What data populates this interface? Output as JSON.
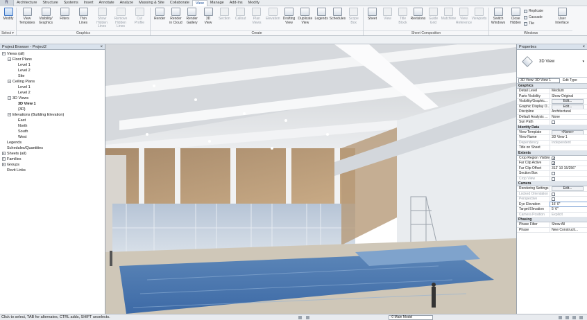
{
  "ribbon_tabs": [
    "Architecture",
    "Structure",
    "Systems",
    "Insert",
    "Annotate",
    "Analyze",
    "Massing & Site",
    "Collaborate",
    "View",
    "Manage",
    "Add-Ins",
    "Modify"
  ],
  "active_tab": "View",
  "ribbon": {
    "modify": "Modify",
    "select": "Select ▾",
    "graphics_buttons": [
      "View\nTemplates",
      "Visibility/\nGraphics",
      "Filters",
      "Thin\nLines",
      "Show\nHidden Lines",
      "Remove\nHidden Lines",
      "Cut\nProfile"
    ],
    "graphics_label": "Graphics",
    "create_buttons": [
      "Render",
      "Render\nin Cloud",
      "Render\nGallery",
      "3D\nView",
      "Section",
      "Callout",
      "Plan\nViews",
      "Elevation",
      "Drafting\nView",
      "Duplicate\nView",
      "Legends",
      "Schedules",
      "Scope\nBox"
    ],
    "create_label": "Create",
    "sheet_buttons": [
      "Sheet",
      "View",
      "Title\nBlock",
      "Revisions",
      "Guide\nGrid",
      "Matchline",
      "View\nReference",
      "Viewports"
    ],
    "sheet_label": "Sheet Composition",
    "window_buttons": [
      "Switch\nWindows",
      "Close\nHidden"
    ],
    "window_small": [
      "Replicate",
      "Cascade",
      "Tile"
    ],
    "user_interface": "User\nInterface",
    "windows_label": "Windows"
  },
  "browser": {
    "title": "Project Browser - Project2",
    "close": "×",
    "rows": [
      {
        "indent": 0,
        "toggle": "−",
        "text": "Views (all)"
      },
      {
        "indent": 1,
        "toggle": "−",
        "text": "Floor Plans"
      },
      {
        "indent": 2,
        "toggle": "",
        "text": "Level 1"
      },
      {
        "indent": 2,
        "toggle": "",
        "text": "Level 2"
      },
      {
        "indent": 2,
        "toggle": "",
        "text": "Site"
      },
      {
        "indent": 1,
        "toggle": "−",
        "text": "Ceiling Plans"
      },
      {
        "indent": 2,
        "toggle": "",
        "text": "Level 1"
      },
      {
        "indent": 2,
        "toggle": "",
        "text": "Level 2"
      },
      {
        "indent": 1,
        "toggle": "−",
        "text": "3D Views"
      },
      {
        "indent": 2,
        "toggle": "",
        "text": "3D View 1",
        "bold": true
      },
      {
        "indent": 2,
        "toggle": "",
        "text": "{3D}"
      },
      {
        "indent": 1,
        "toggle": "−",
        "text": "Elevations (Building Elevation)"
      },
      {
        "indent": 2,
        "toggle": "",
        "text": "East"
      },
      {
        "indent": 2,
        "toggle": "",
        "text": "North"
      },
      {
        "indent": 2,
        "toggle": "",
        "text": "South"
      },
      {
        "indent": 2,
        "toggle": "",
        "text": "West"
      },
      {
        "indent": 0,
        "toggle": "",
        "text": "Legends"
      },
      {
        "indent": 0,
        "toggle": "",
        "text": "Schedules/Quantities"
      },
      {
        "indent": 0,
        "toggle": "+",
        "text": "Sheets (all)"
      },
      {
        "indent": 0,
        "toggle": "+",
        "text": "Families"
      },
      {
        "indent": 0,
        "toggle": "+",
        "text": "Groups"
      },
      {
        "indent": 0,
        "toggle": "",
        "text": "Revit Links"
      }
    ]
  },
  "properties": {
    "title": "Properties",
    "close": "×",
    "type_name": "3D View",
    "selector": "3D View: 3D View 1",
    "edit_type": "Edit Type",
    "groups": [
      {
        "name": "Graphics",
        "rows": [
          {
            "k": "Detail Level",
            "v": "Medium"
          },
          {
            "k": "Parts Visibility",
            "v": "Show Original"
          },
          {
            "k": "Visibility/Graphic...",
            "v": "Edit...",
            "btn": true
          },
          {
            "k": "Graphic Display O...",
            "v": "Edit...",
            "btn": true
          },
          {
            "k": "Discipline",
            "v": "Architectural"
          },
          {
            "k": "Default Analysis ...",
            "v": "None"
          },
          {
            "k": "Sun Path",
            "v": "",
            "cb": true
          }
        ]
      },
      {
        "name": "Identity Data",
        "rows": [
          {
            "k": "View Template",
            "v": "<None>",
            "btn": true
          },
          {
            "k": "View Name",
            "v": "3D View 1"
          },
          {
            "k": "Dependency",
            "v": "Independent",
            "dim": true
          },
          {
            "k": "Title on Sheet",
            "v": ""
          }
        ]
      },
      {
        "name": "Extents",
        "rows": [
          {
            "k": "Crop Region Visible",
            "v": "✓",
            "cb": true
          },
          {
            "k": "Far Clip Active",
            "v": "✓",
            "cb": true
          },
          {
            "k": "Far Clip Offset",
            "v": "312' 10 15/256\""
          },
          {
            "k": "Section Box",
            "v": "",
            "cb": true
          },
          {
            "k": "Crop View",
            "v": "",
            "cb": true,
            "dim": true
          }
        ]
      },
      {
        "name": "Camera",
        "rows": [
          {
            "k": "Rendering Settings",
            "v": "Edit...",
            "btn": true
          },
          {
            "k": "Locked Orientation",
            "v": "",
            "cb": true,
            "dim": true
          },
          {
            "k": "Perspective",
            "v": "",
            "cb": true,
            "dim": true
          },
          {
            "k": "Eye Elevation",
            "v": "15' 0\"",
            "hi": true
          },
          {
            "k": "Target Elevation",
            "v": "5' 6\""
          },
          {
            "k": "Camera Position",
            "v": "Explicit",
            "dim": true
          }
        ]
      },
      {
        "name": "Phasing",
        "rows": [
          {
            "k": "Phase Filter",
            "v": "Show All"
          },
          {
            "k": "Phase",
            "v": "New Constructi..."
          }
        ]
      }
    ]
  },
  "status": {
    "text": "Click to select, TAB for alternates, CTRL adds, SHIFT unselects.",
    "model": ":0    Main Model"
  }
}
